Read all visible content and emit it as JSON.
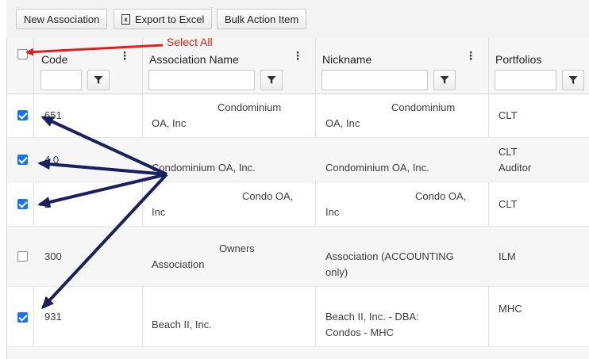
{
  "toolbar": {
    "new_association": "New Association",
    "export_excel": "Export to Excel",
    "excel_icon_glyph": "x",
    "bulk_action": "Bulk Action Item"
  },
  "columns": {
    "code": "Code",
    "association_name": "Association Name",
    "nickname": "Nickname",
    "portfolios": "Portfolios"
  },
  "annotation": {
    "select_all": "Select All"
  },
  "rows": [
    {
      "checked": true,
      "code": "651",
      "name1": "Condominium",
      "name2": "OA, Inc",
      "nick1": "Condominium",
      "nick2": "OA, Inc",
      "port1": "CLT",
      "port2": ""
    },
    {
      "checked": true,
      "code": "4 0",
      "name1": "",
      "name2": "Condominium OA, Inc.",
      "nick1": "",
      "nick2": "Condominium OA, Inc.",
      "port1": "CLT",
      "port2": "Auditor"
    },
    {
      "checked": true,
      "code": "2",
      "name1": "Condo OA,",
      "name2": "Inc",
      "nick1": "Condo OA,",
      "nick2": "Inc",
      "port1": "CLT",
      "port2": ""
    },
    {
      "checked": false,
      "code": "300",
      "name1": "Owners",
      "name2": "Association",
      "nick1": "Association (ACCOUNTING",
      "nick2": "only)",
      "port1": "ILM",
      "port2": ""
    },
    {
      "checked": true,
      "code": "931",
      "name1": "",
      "name2": "Beach II, Inc.",
      "nick1": "Beach II, Inc. - DBA:",
      "nick2": "Condos - MHC",
      "port1": "MHC",
      "port2": ""
    }
  ],
  "colors": {
    "checkbox": "#1a73e8",
    "arrow_red": "#e02020",
    "arrow_navy": "#1a1f5e"
  }
}
